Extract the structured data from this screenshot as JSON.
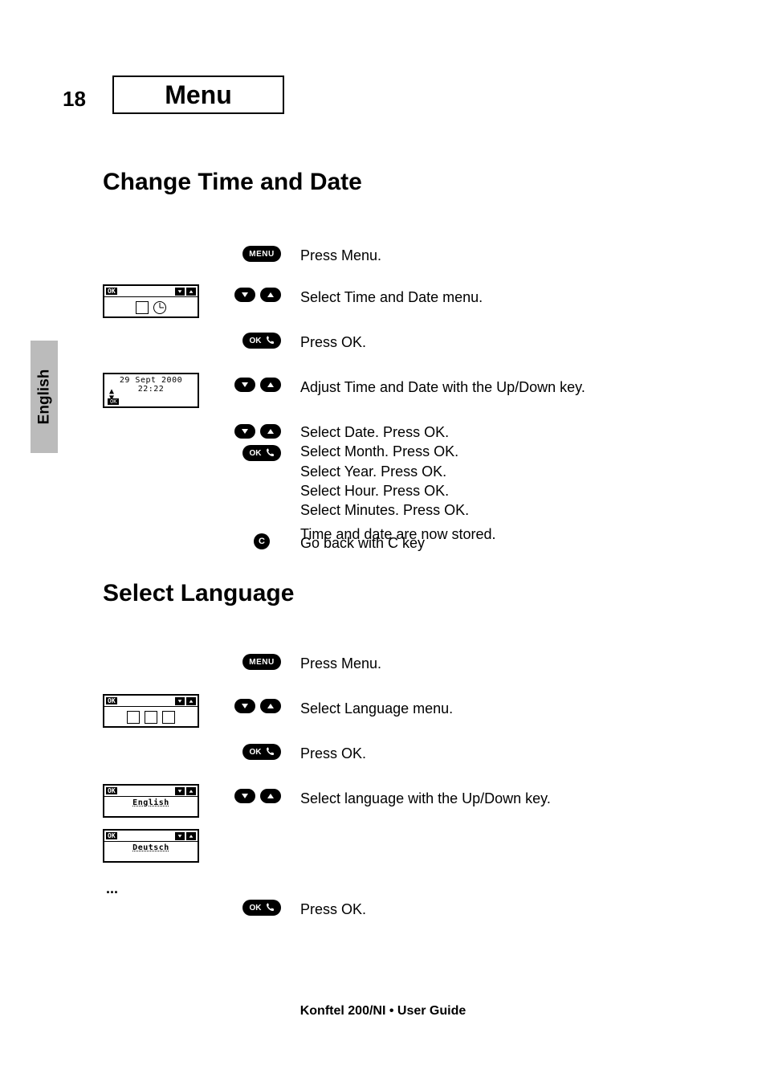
{
  "page_number": "18",
  "page_title": "Menu",
  "side_tab": "English",
  "sections": {
    "change_time": {
      "heading": "Change Time and Date",
      "steps": {
        "s1": "Press Menu.",
        "s2": "Select Time and Date menu.",
        "s3": "Press OK.",
        "s4": "Adjust Time and Date with the Up/Down key.",
        "s5a": "Select Date. Press OK.",
        "s5b": "Select Month. Press OK.",
        "s5c": "Select Year. Press OK.",
        "s5d": "Select Hour. Press OK.",
        "s5e": "Select Minutes. Press OK.",
        "s5f": "Time and date are now stored.",
        "s6": "Go back with C key"
      },
      "lcd": {
        "ok_label": "OK",
        "date_line": "29 Sept 2000 22:22"
      }
    },
    "select_language": {
      "heading": "Select Language",
      "steps": {
        "s1": "Press Menu.",
        "s2": "Select Language menu.",
        "s3": "Press OK.",
        "s4": "Select language with the Up/Down key.",
        "s5": "Press OK."
      },
      "lcd": {
        "ok_label": "OK",
        "lang1": "English",
        "lang2": "Deutsch"
      }
    }
  },
  "ellipsis": "...",
  "buttons": {
    "menu_label": "MENU",
    "ok_label": "OK",
    "c_label": "C"
  },
  "footer": "Konftel 200/NI • User Guide"
}
